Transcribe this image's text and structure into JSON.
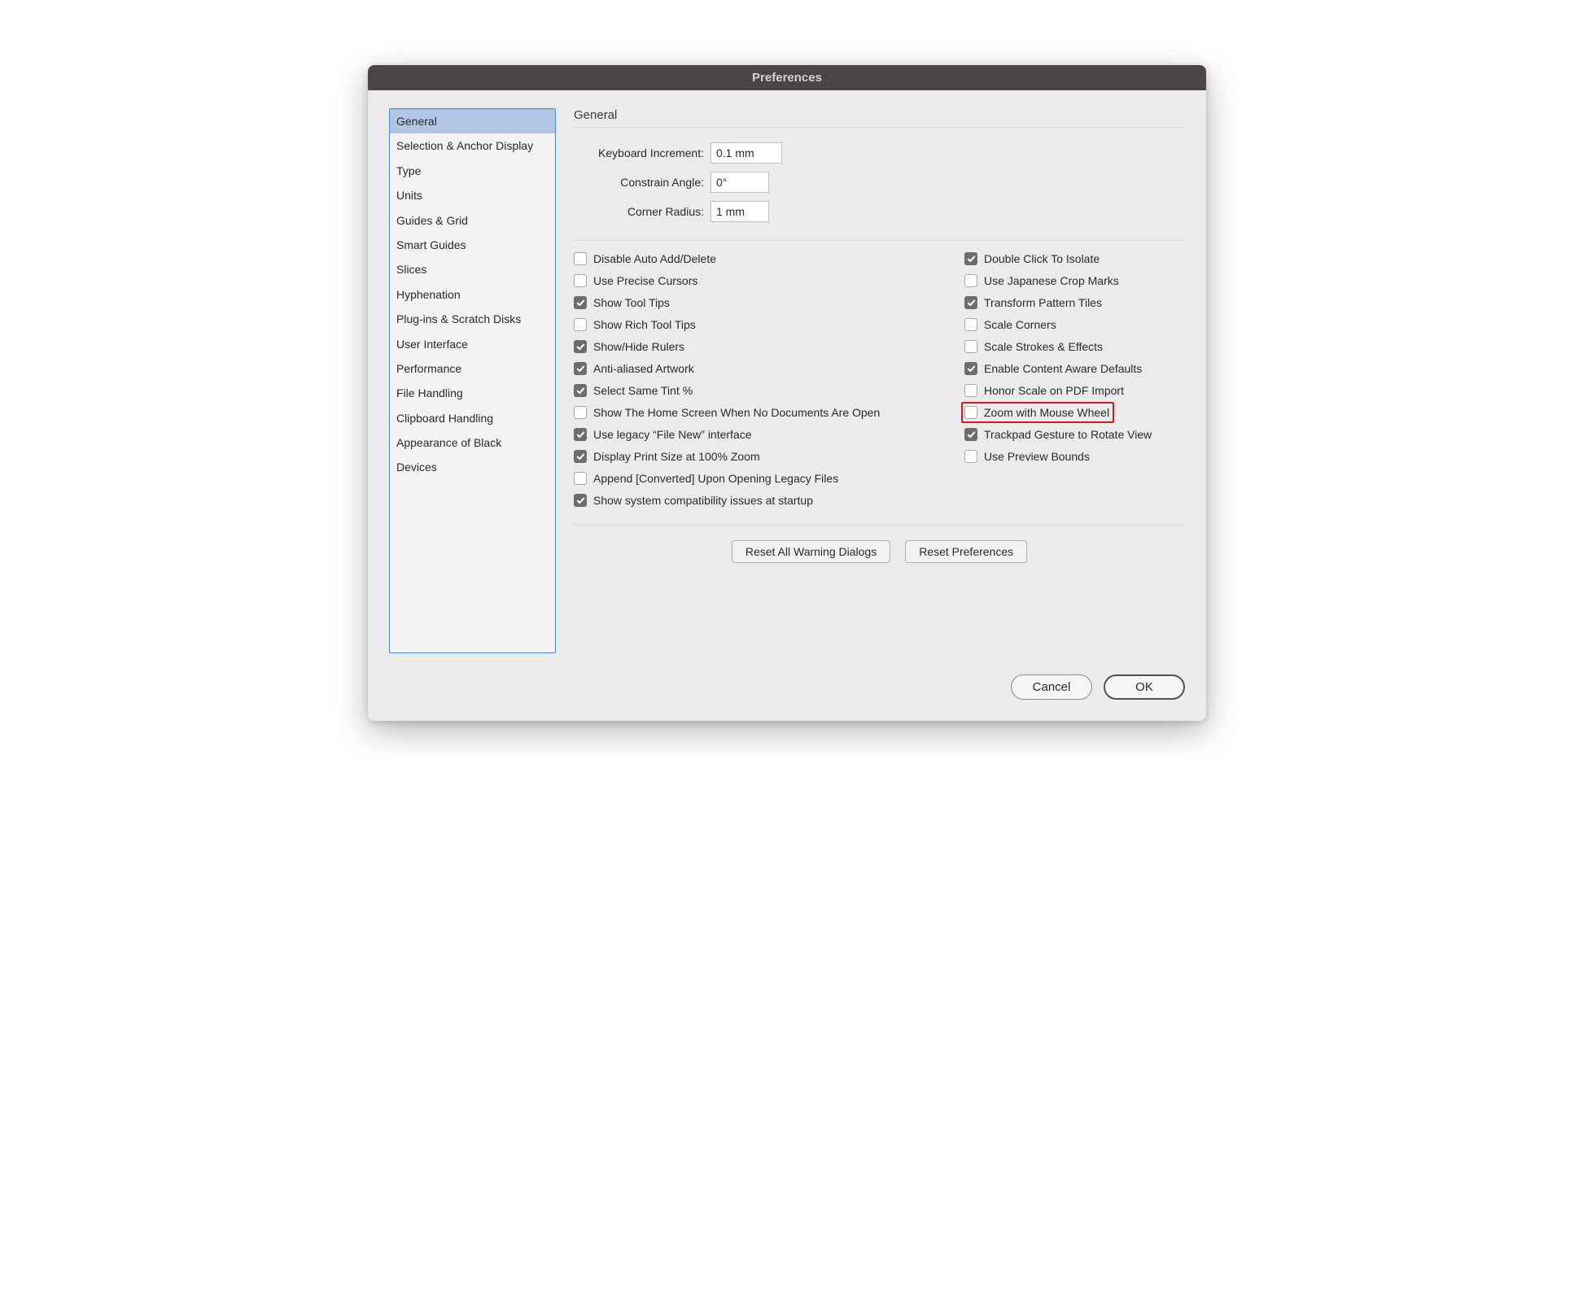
{
  "window": {
    "title": "Preferences"
  },
  "sidebar": {
    "items": [
      "General",
      "Selection & Anchor Display",
      "Type",
      "Units",
      "Guides & Grid",
      "Smart Guides",
      "Slices",
      "Hyphenation",
      "Plug-ins & Scratch Disks",
      "User Interface",
      "Performance",
      "File Handling",
      "Clipboard Handling",
      "Appearance of Black",
      "Devices"
    ],
    "selected_index": 0
  },
  "main": {
    "section_title": "General",
    "fields": {
      "keyboard_increment": {
        "label": "Keyboard Increment:",
        "value": "0.1 mm"
      },
      "constrain_angle": {
        "label": "Constrain Angle:",
        "value": "0°"
      },
      "corner_radius": {
        "label": "Corner Radius:",
        "value": "1 mm"
      }
    },
    "checkboxes_left": [
      {
        "label": "Disable Auto Add/Delete",
        "checked": false
      },
      {
        "label": "Use Precise Cursors",
        "checked": false
      },
      {
        "label": "Show Tool Tips",
        "checked": true
      },
      {
        "label": "Show Rich Tool Tips",
        "checked": false
      },
      {
        "label": "Show/Hide Rulers",
        "checked": true
      },
      {
        "label": "Anti-aliased Artwork",
        "checked": true
      },
      {
        "label": "Select Same Tint %",
        "checked": true
      },
      {
        "label": "Show The Home Screen When No Documents Are Open",
        "checked": false
      },
      {
        "label": "Use legacy “File New” interface",
        "checked": true
      },
      {
        "label": "Display Print Size at 100% Zoom",
        "checked": true
      },
      {
        "label": "Append [Converted] Upon Opening Legacy Files",
        "checked": false
      },
      {
        "label": "Show system compatibility issues at startup",
        "checked": true
      }
    ],
    "checkboxes_right": [
      {
        "label": "Double Click To Isolate",
        "checked": true
      },
      {
        "label": "Use Japanese Crop Marks",
        "checked": false
      },
      {
        "label": "Transform Pattern Tiles",
        "checked": true
      },
      {
        "label": "Scale Corners",
        "checked": false
      },
      {
        "label": "Scale Strokes & Effects",
        "checked": false
      },
      {
        "label": "Enable Content Aware Defaults",
        "checked": true
      },
      {
        "label": "Honor Scale on PDF Import",
        "checked": false
      },
      {
        "label": "Zoom with Mouse Wheel",
        "checked": false,
        "highlighted": true
      },
      {
        "label": "Trackpad Gesture to Rotate View",
        "checked": true
      },
      {
        "label": "Use Preview Bounds",
        "checked": false
      }
    ],
    "buttons": {
      "reset_warnings": "Reset All Warning Dialogs",
      "reset_prefs": "Reset Preferences"
    }
  },
  "footer": {
    "cancel": "Cancel",
    "ok": "OK"
  }
}
